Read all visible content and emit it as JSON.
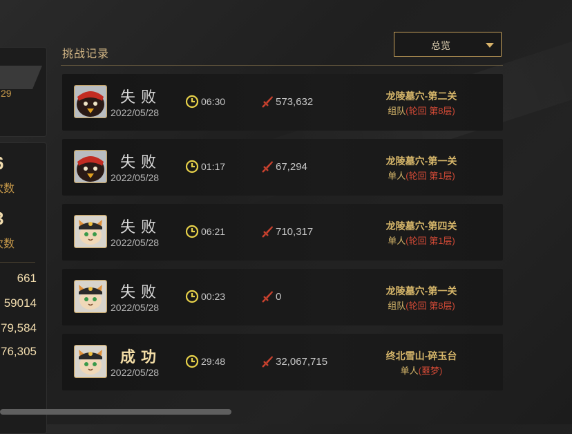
{
  "header": {
    "title": "挑战记录",
    "dropdown_label": "总览"
  },
  "left_panel": {
    "top_value": "29",
    "big1": "6",
    "label1": "次数",
    "big2": "3",
    "label2": "次数",
    "stats": [
      "661",
      "59014",
      "79,584",
      "76,305"
    ]
  },
  "records": [
    {
      "result": "失败",
      "date": "2022/05/28",
      "time": "06:30",
      "damage": "573,632",
      "stage": "龙陵墓穴-第二关",
      "mode_prefix": "组队",
      "mode_paren": "(轮回  第8层)",
      "avatar": "red-bird"
    },
    {
      "result": "失败",
      "date": "2022/05/28",
      "time": "01:17",
      "damage": "67,294",
      "stage": "龙陵墓穴-第一关",
      "mode_prefix": "单人",
      "mode_paren": "(轮回  第1层)",
      "avatar": "red-bird"
    },
    {
      "result": "失败",
      "date": "2022/05/28",
      "time": "06:21",
      "damage": "710,317",
      "stage": "龙陵墓穴-第四关",
      "mode_prefix": "单人",
      "mode_paren": "(轮回  第1层)",
      "avatar": "cat"
    },
    {
      "result": "失败",
      "date": "2022/05/28",
      "time": "00:23",
      "damage": "0",
      "stage": "龙陵墓穴-第一关",
      "mode_prefix": "组队",
      "mode_paren": "(轮回  第8层)",
      "avatar": "cat"
    },
    {
      "result": "成功",
      "date": "2022/05/28",
      "time": "29:48",
      "damage": "32,067,715",
      "stage": "终北雪山-碎玉台",
      "mode_prefix": "单人",
      "mode_paren": "(噩梦)",
      "avatar": "cat"
    }
  ],
  "colors": {
    "gold": "#d6b66a",
    "red": "#d24a36",
    "accent_border": "#c7a15a"
  },
  "icons": {
    "clock": "clock-icon",
    "damage": "sword-icon",
    "dropdown": "caret-down-icon"
  }
}
